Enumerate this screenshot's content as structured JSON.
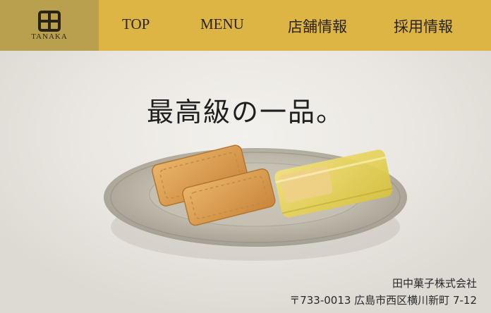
{
  "brand": {
    "name": "TANAKA",
    "mark": "田"
  },
  "nav": {
    "items": [
      {
        "label": "TOP"
      },
      {
        "label": "MENU"
      },
      {
        "label": "店舗情報"
      },
      {
        "label": "採用情報"
      }
    ]
  },
  "hero": {
    "headline": "最高級の一品。"
  },
  "footer": {
    "company": "田中菓子株式会社",
    "address": "〒733-0013 広島市西区横川新町 7-12"
  },
  "colors": {
    "header_bg": "#ddb545",
    "logo_bg": "#b9a04e"
  }
}
